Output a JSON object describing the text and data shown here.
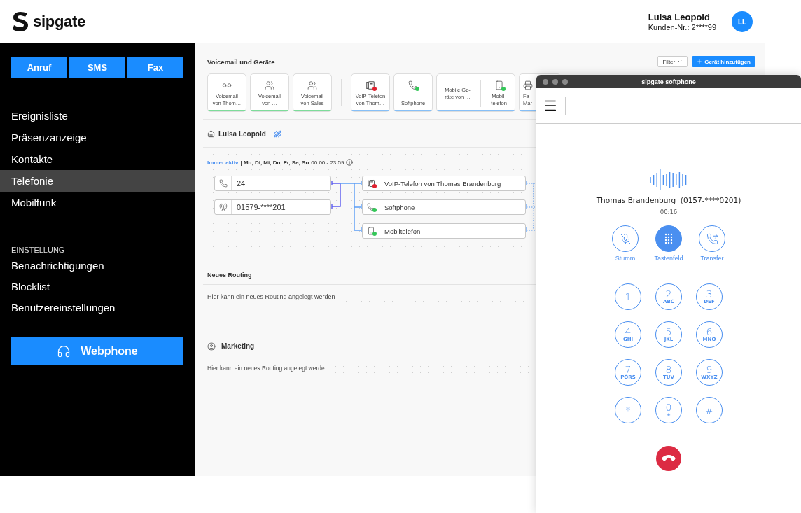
{
  "header": {
    "logo": "sipgate",
    "user_name": "Luisa Leopold",
    "customer_no": "Kunden-Nr.: 2****99",
    "initials": "LL"
  },
  "sidebar": {
    "actions": [
      "Anruf",
      "SMS",
      "Fax"
    ],
    "nav": [
      {
        "label": "Ereignisliste",
        "selected": false
      },
      {
        "label": "Präsenzanzeige",
        "selected": false
      },
      {
        "label": "Kontakte",
        "selected": false
      },
      {
        "label": "Telefonie",
        "selected": true
      },
      {
        "label": "Mobilfunk",
        "selected": false
      }
    ],
    "settings_heading": "EINSTELLUNG",
    "settings": [
      {
        "label": "Benachrichtigungen",
        "selected": false
      },
      {
        "label": "Blocklist",
        "selected": false
      },
      {
        "label": "Benutzereinstellungen",
        "selected": false
      }
    ],
    "webphone": "Webphone"
  },
  "devices": {
    "title": "Voicemail und Geräte",
    "filter": "Filter",
    "add": "Gerät hinzufügen",
    "voicemails": [
      {
        "kind": "voicemail",
        "label": "Voicemail\nvon Thom…",
        "color": "#7ddc9a"
      },
      {
        "kind": "group",
        "label": "Voicemail\nvon …",
        "color": "#7ddc9a"
      },
      {
        "kind": "group",
        "label": "Voicemail\nvon Sales",
        "color": "#7ddc9a"
      }
    ],
    "devices": [
      {
        "kind": "deskphone",
        "label": "VoIP-Telefon\nvon Thom…",
        "color": "#86bff7",
        "status": {
          "color": "#e0202e"
        }
      },
      {
        "kind": "softphone",
        "label": "Softphone",
        "color": "#86bff7",
        "status": {
          "color": "#35c759"
        }
      },
      {
        "kind": "group",
        "label": "Mobile Ge-\nräte von …",
        "color": "#86bff7",
        "member": {
          "kind": "mobile",
          "label": "Mobil-\ntelefon",
          "color": "#35c759"
        }
      },
      {
        "kind": "fax",
        "label": "Fa\nMar",
        "color": "#86bff7"
      }
    ]
  },
  "routing": {
    "title": "Luisa Leopold",
    "status": "Immer aktiv",
    "days": "| Mo, Di, Mi, Do, Fr, Sa, So",
    "hours": "00:00 - 23:59",
    "sources": [
      {
        "kind": "phone",
        "label": "24"
      },
      {
        "kind": "antenna",
        "label": "01579-****201"
      }
    ],
    "targets": [
      {
        "kind": "deskphone",
        "label": "VoIP-Telefon von Thomas Brandenburg",
        "color": "#e0202e"
      },
      {
        "kind": "softphone",
        "label": "Softphone",
        "color": "#35c759"
      },
      {
        "kind": "mobile",
        "label": "Mobiltelefon",
        "color": "#35c759"
      }
    ]
  },
  "other_routings": [
    {
      "kind": "new",
      "title": "Neues Routing",
      "hint": "Hier kann ein neues Routing angelegt werden"
    },
    {
      "kind": "team",
      "title": "Marketing",
      "hint": "Hier kann ein neues Routing angelegt werde"
    }
  ],
  "softphone": {
    "title": "sipgate softphone",
    "caller": "Thomas Brandenburg  (0157-****0201)",
    "duration": "00:16",
    "actions": [
      {
        "kind": "mute",
        "label": "Stumm",
        "selected": false
      },
      {
        "kind": "keypad",
        "label": "Tastenfeld",
        "selected": true
      },
      {
        "kind": "transfer",
        "label": "Transfer",
        "selected": false
      }
    ],
    "keys": [
      {
        "digit": "1"
      },
      {
        "digit": "2",
        "letters": "ABC"
      },
      {
        "digit": "3",
        "letters": "DEF"
      },
      {
        "digit": "4",
        "letters": "GHI"
      },
      {
        "digit": "5",
        "letters": "JKL"
      },
      {
        "digit": "6",
        "letters": "MNO"
      },
      {
        "digit": "7",
        "letters": "PQRS"
      },
      {
        "digit": "8",
        "letters": "TUV"
      },
      {
        "digit": "9",
        "letters": "WXYZ"
      },
      {
        "digit": "*"
      },
      {
        "digit": "0",
        "letters": "+"
      },
      {
        "digit": "#"
      }
    ]
  }
}
